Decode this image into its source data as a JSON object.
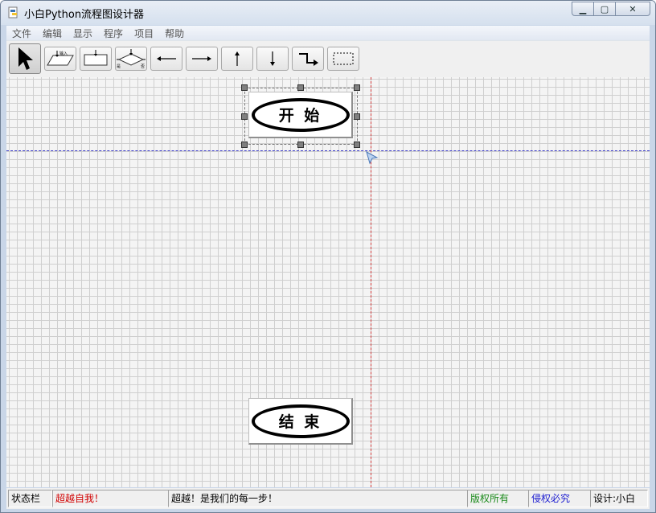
{
  "window": {
    "title": "小白Python流程图设计器"
  },
  "window_controls": {
    "minimize": "▁",
    "maximize": "▢",
    "close": "✕"
  },
  "menu": [
    "文件",
    "编辑",
    "显示",
    "程序",
    "项目",
    "帮助"
  ],
  "toolbar": {
    "tools": [
      {
        "name": "pointer-tool",
        "icon": "arrow-cursor-icon",
        "active": true
      },
      {
        "name": "input-tool",
        "icon": "parallelogram-input-icon",
        "label": "输入"
      },
      {
        "name": "process-tool",
        "icon": "process-box-icon"
      },
      {
        "name": "decision-tool",
        "icon": "diamond-decision-icon",
        "yes": "是",
        "no": "否"
      },
      {
        "name": "arrow-left-tool",
        "icon": "arrow-left-icon"
      },
      {
        "name": "arrow-right-tool",
        "icon": "arrow-right-icon"
      },
      {
        "name": "arrow-up-tool",
        "icon": "arrow-up-icon"
      },
      {
        "name": "arrow-down-tool",
        "icon": "arrow-down-icon"
      },
      {
        "name": "elbow-connector-tool",
        "icon": "elbow-arrow-icon"
      },
      {
        "name": "select-rect-tool",
        "icon": "dashed-rect-icon"
      }
    ]
  },
  "canvas": {
    "shapes": [
      {
        "id": "start",
        "label": "开 始",
        "selected": true
      },
      {
        "id": "end",
        "label": "结 束",
        "selected": false
      }
    ],
    "guides": {
      "horizontal_color": "#3b3bc9",
      "vertical_color": "#d23a3a"
    }
  },
  "statusbar": {
    "label": "状态栏",
    "slogan": "超越自我！",
    "message": "超越！是我们的每一步！",
    "copyright": "版权所有",
    "warning": "侵权必究",
    "designer": "设计:小白",
    "colors": {
      "slogan": "#d10000",
      "copyright": "#1a8a1a",
      "warning": "#1a1ad0",
      "default": "#000000"
    }
  }
}
